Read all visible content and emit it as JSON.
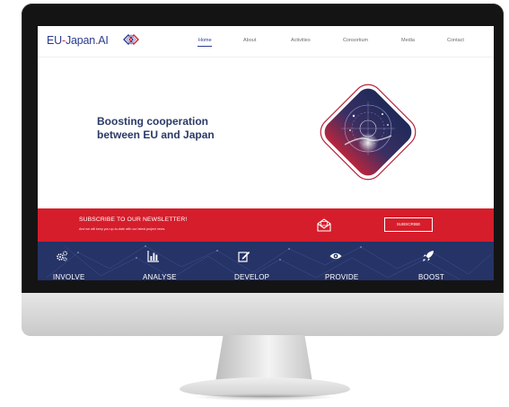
{
  "header": {
    "logo": {
      "part1": "EU",
      "dash": "-",
      "part2": "Japan",
      "dot": ".",
      "part3": "AI"
    },
    "nav": [
      {
        "label": "Home",
        "active": true
      },
      {
        "label": "About"
      },
      {
        "label": "Activities"
      },
      {
        "label": "Consortium"
      },
      {
        "label": "Media"
      },
      {
        "label": "Contact"
      }
    ]
  },
  "hero": {
    "title": "Boosting cooperation between EU and Japan"
  },
  "newsletter": {
    "title": "SUBSCRIBE TO OUR NEWSLETTER!",
    "subtitle": "And we will keep you up-to-date with our latest project news.",
    "button": "SUBSCRIBE"
  },
  "features": [
    {
      "label": "INVOLVE",
      "icon": "gears-icon"
    },
    {
      "label": "ANALYSE",
      "icon": "bar-chart-icon"
    },
    {
      "label": "DEVELOP",
      "icon": "edit-icon"
    },
    {
      "label": "PROVIDE",
      "icon": "eye-icon"
    },
    {
      "label": "BOOST",
      "icon": "rocket-icon"
    }
  ],
  "colors": {
    "brand_blue": "#2b3b8f",
    "brand_red": "#d61d2b",
    "features_bg": "#253367"
  }
}
